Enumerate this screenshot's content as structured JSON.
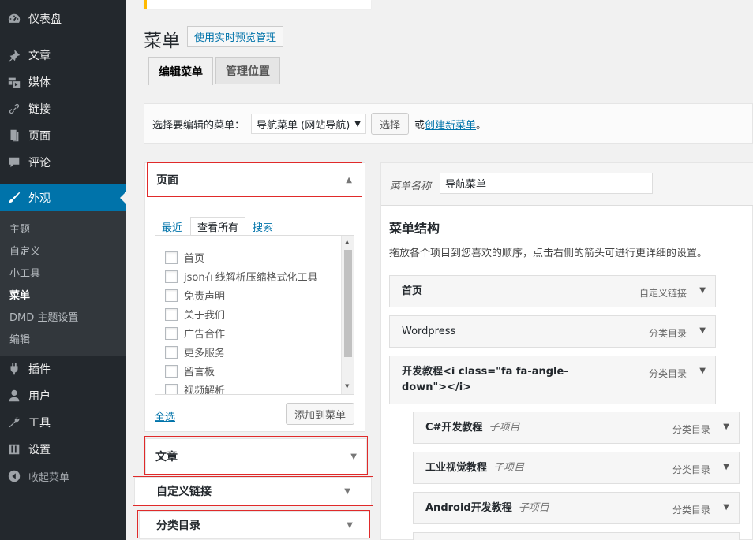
{
  "sidebar": {
    "items": [
      {
        "label": "仪表盘",
        "icon": "dashboard-icon"
      },
      {
        "label": "文章",
        "icon": "pin-icon"
      },
      {
        "label": "媒体",
        "icon": "media-icon"
      },
      {
        "label": "链接",
        "icon": "link-icon"
      },
      {
        "label": "页面",
        "icon": "page-icon"
      },
      {
        "label": "评论",
        "icon": "comment-icon"
      },
      {
        "label": "外观",
        "icon": "brush-icon"
      }
    ],
    "submenu": [
      "主题",
      "自定义",
      "小工具",
      "菜单",
      "DMD 主题设置",
      "编辑"
    ],
    "bottom": [
      {
        "label": "插件",
        "icon": "plugin-icon"
      },
      {
        "label": "用户",
        "icon": "user-icon"
      },
      {
        "label": "工具",
        "icon": "wrench-icon"
      },
      {
        "label": "设置",
        "icon": "settings-icon"
      }
    ],
    "collapse_label": "收起菜单"
  },
  "header": {
    "title": "菜单",
    "preview_button": "使用实时预览管理",
    "tabs": [
      "编辑菜单",
      "管理位置"
    ]
  },
  "select_bar": {
    "label": "选择要编辑的菜单：",
    "selected": "导航菜单 (网站导航)",
    "button": "选择",
    "or_text": "或",
    "create_link": "创建新菜单",
    "period": "。"
  },
  "left": {
    "pages_title": "页面",
    "inner_tabs": [
      "最近",
      "查看所有",
      "搜索"
    ],
    "pages": [
      "首页",
      "json在线解析压缩格式化工具",
      "免责声明",
      "关于我们",
      "广告合作",
      "更多服务",
      "留言板",
      "视频解析"
    ],
    "select_all": "全选",
    "add_button": "添加到菜单",
    "sections": [
      "文章",
      "自定义链接",
      "分类目录"
    ]
  },
  "right": {
    "name_label": "菜单名称",
    "name_value": "导航菜单",
    "structure_title": "菜单结构",
    "structure_desc": "拖放各个项目到您喜欢的顺序，点击右侧的箭头可进行更详细的设置。",
    "items": [
      {
        "title": "首页",
        "type": "自定义链接"
      },
      {
        "title": "Wordpress",
        "type": "分类目录"
      },
      {
        "title_line1": "开发教程<i class=\"fa fa-angle-",
        "title_line2": "down\"></i>",
        "type": "分类目录"
      },
      {
        "title": "C#开发教程",
        "sub": "子项目",
        "type": "分类目录"
      },
      {
        "title": "工业视觉教程",
        "sub": "子项目",
        "type": "分类目录"
      },
      {
        "title": "Android开发教程",
        "sub": "子项目",
        "type": "分类目录"
      }
    ]
  },
  "colors": {
    "sidebar": "#23282d",
    "active": "#0073aa",
    "highlight_border": "#e02a2a"
  }
}
